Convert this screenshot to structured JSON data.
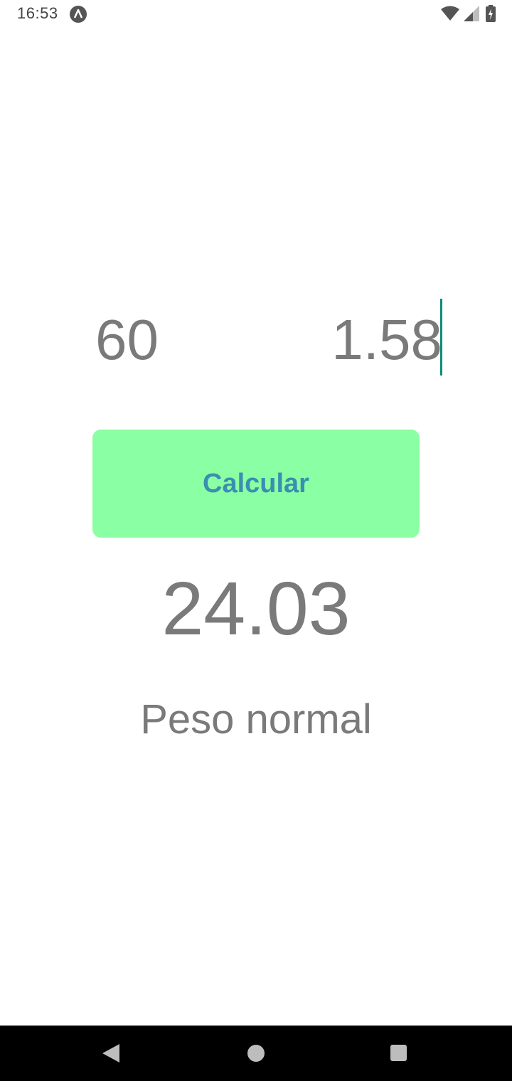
{
  "status_bar": {
    "time": "16:53",
    "icons": [
      "notification-app-icon",
      "wifi-icon",
      "signal-icon",
      "battery-charging-icon"
    ]
  },
  "form": {
    "weight_value": "60",
    "height_value": "1.58"
  },
  "button": {
    "label": "Calcular"
  },
  "result": {
    "value": "24.03",
    "category": "Peso normal"
  },
  "nav_bar": {
    "icons": [
      "back-icon",
      "home-icon",
      "recents-icon"
    ]
  },
  "colors": {
    "button_bg": "#8bffa3",
    "button_text": "#3a8fb0",
    "text_gray": "#7a7a7a",
    "cursor": "#0e8c7a"
  }
}
